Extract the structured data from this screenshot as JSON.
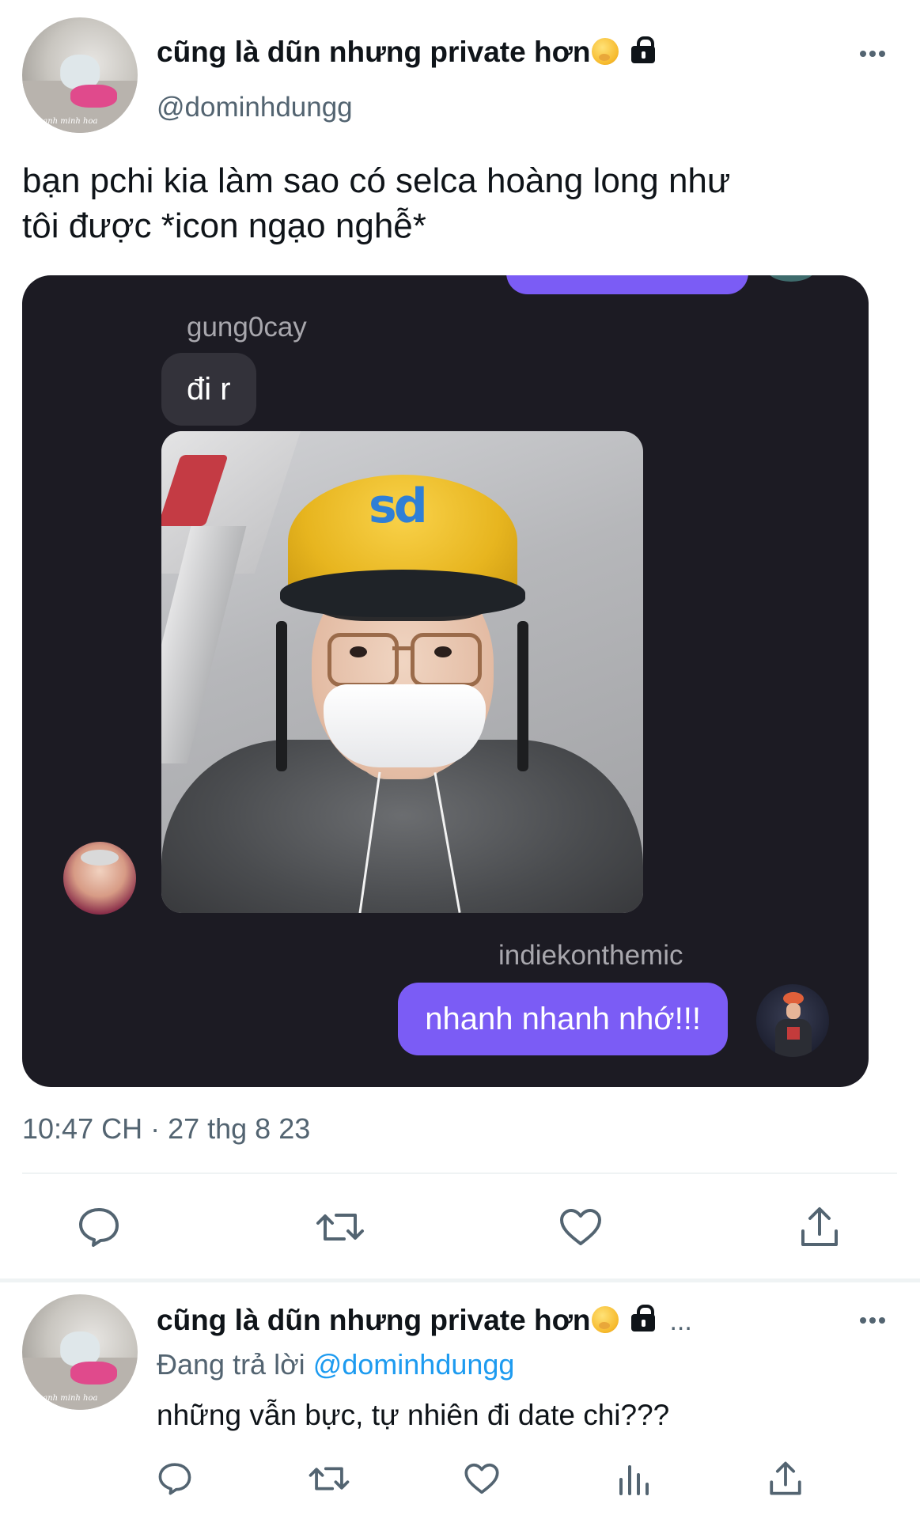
{
  "tweet": {
    "display_name": "cũng là dũn nhưng private hơn",
    "handle": "@dominhdungg",
    "avatar_caption": "anh minh hoa",
    "text_line1": "bạn pchi kia làm sao có selca hoàng long như",
    "text_line2": "tôi được *icon ngạo nghễ*",
    "timestamp": "10:47 CH · 27 thg 8 23",
    "more_icon": "more-dots-icon",
    "lock_icon": "lock-icon"
  },
  "chat_screenshot": {
    "sender1": "gung0cay",
    "message1": "đi r",
    "sender2": "indiekonthemic",
    "message2": "nhanh nhanh nhớ!!!",
    "helmet_logo": "sd",
    "accent_color": "#7B5CF5",
    "background_color": "#1C1B23"
  },
  "actions": {
    "reply": "reply-icon",
    "retweet": "retweet-icon",
    "like": "heart-icon",
    "share": "share-icon",
    "views": "views-icon"
  },
  "reply_tweet": {
    "display_name": "cũng là dũn nhưng private hơn",
    "ellipsis": "...",
    "replying_prefix": "Đang trả lời",
    "replying_to": "@dominhdungg",
    "text": "những vẫn bực, tự nhiên đi date chi???"
  }
}
